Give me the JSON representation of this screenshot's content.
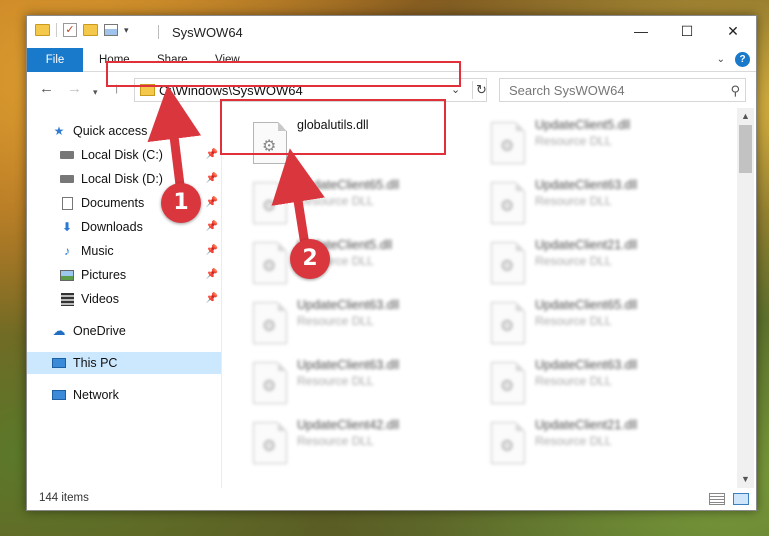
{
  "window": {
    "title": "SysWOW64",
    "controls": {
      "minimize": "—",
      "maximize": "☐",
      "close": "✕"
    }
  },
  "ribbon": {
    "tabs": [
      "File",
      "Home",
      "Share",
      "View"
    ],
    "help": "?"
  },
  "address": {
    "path": "C:\\Windows\\SysWOW64",
    "search_placeholder": "Search SysWOW64"
  },
  "sidebar": {
    "quick_access": "Quick access",
    "items": [
      {
        "label": "Local Disk (C:)",
        "icon": "drive-icon",
        "pinned": true
      },
      {
        "label": "Local Disk (D:)",
        "icon": "drive-icon",
        "pinned": true
      },
      {
        "label": "Documents",
        "icon": "documents-icon",
        "pinned": true
      },
      {
        "label": "Downloads",
        "icon": "downloads-icon",
        "pinned": true
      },
      {
        "label": "Music",
        "icon": "music-icon",
        "pinned": true
      },
      {
        "label": "Pictures",
        "icon": "pictures-icon",
        "pinned": true
      },
      {
        "label": "Videos",
        "icon": "videos-icon",
        "pinned": true
      }
    ],
    "onedrive": "OneDrive",
    "this_pc": "This PC",
    "network": "Network"
  },
  "files": {
    "highlighted": {
      "name": "globalutils.dll"
    },
    "left_column": [
      {
        "name": "UpdateClient65.dll",
        "type": "Resource DLL"
      },
      {
        "name": "UpdateClient5.dll",
        "type": "Resource DLL"
      },
      {
        "name": "UpdateClient63.dll",
        "type": "Resource DLL"
      },
      {
        "name": "UpdateClient63.dll",
        "type": "Resource DLL"
      },
      {
        "name": "UpdateClient42.dll",
        "type": "Resource DLL"
      }
    ],
    "right_column": [
      {
        "name": "UpdateClient5.dll",
        "type": "Resource DLL"
      },
      {
        "name": "UpdateClient63.dll",
        "type": "Resource DLL"
      },
      {
        "name": "UpdateClient21.dll",
        "type": "Resource DLL"
      },
      {
        "name": "UpdateClient65.dll",
        "type": "Resource DLL"
      },
      {
        "name": "UpdateClient63.dll",
        "type": "Resource DLL"
      },
      {
        "name": "UpdateClient21.dll",
        "type": "Resource DLL"
      }
    ]
  },
  "status": {
    "item_count": "144 items"
  },
  "annotations": {
    "step1": "1",
    "step2": "2",
    "color": "#d9363e"
  }
}
